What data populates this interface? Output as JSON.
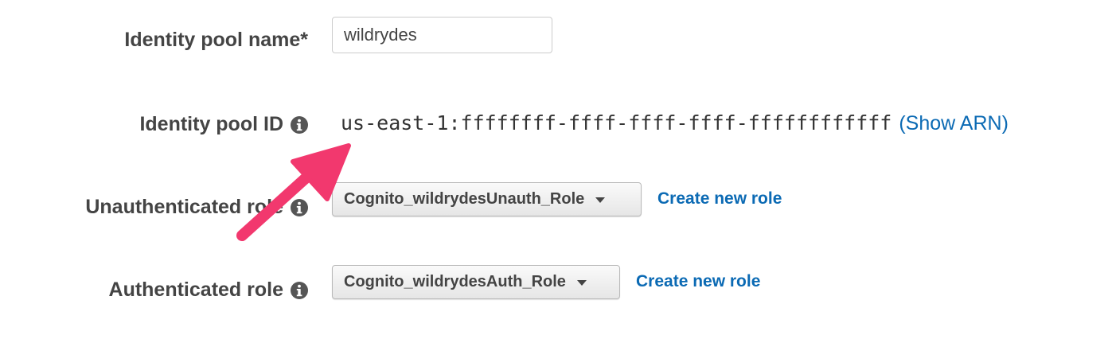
{
  "form": {
    "identity_pool_name": {
      "label": "Identity pool name*",
      "value": "wildrydes"
    },
    "identity_pool_id": {
      "label": "Identity pool ID",
      "value": "us-east-1:ffffffff-ffff-ffff-ffff-ffffffffffff",
      "show_arn_link": "(Show ARN)"
    },
    "unauthenticated_role": {
      "label": "Unauthenticated role",
      "selected": "Cognito_wildrydesUnauth_Role",
      "create_link": "Create new role"
    },
    "authenticated_role": {
      "label": "Authenticated role",
      "selected": "Cognito_wildrydesAuth_Role",
      "create_link": "Create new role"
    }
  },
  "icons": {
    "info": "info-circle-icon",
    "caret": "caret-down-icon",
    "annotation": "annotation-arrow"
  },
  "colors": {
    "label_text": "#444444",
    "link": "#0b6ab4",
    "annotation_arrow": "#f2386e",
    "input_border": "#cccccc"
  }
}
